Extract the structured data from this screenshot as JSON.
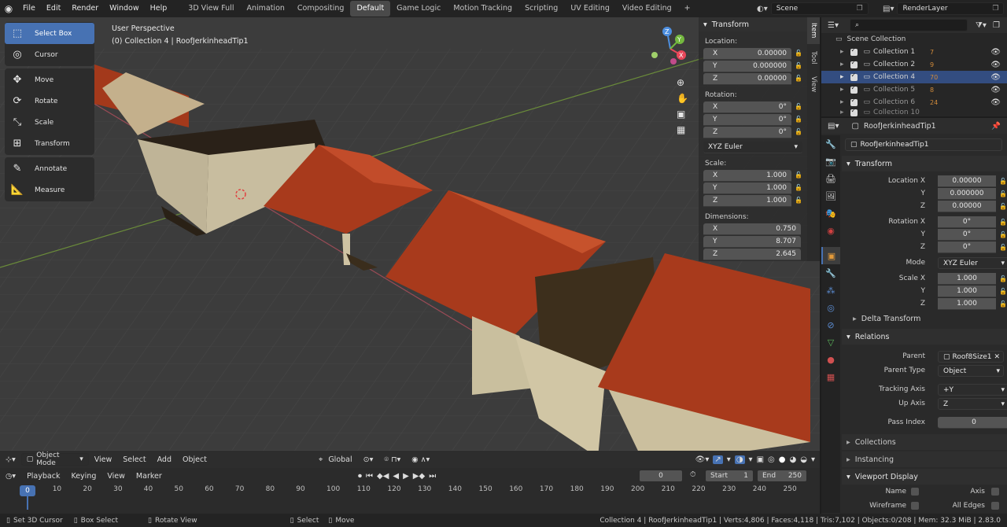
{
  "menus": [
    "File",
    "Edit",
    "Render",
    "Window",
    "Help"
  ],
  "workspaces": [
    {
      "label": "3D View Full",
      "active": false
    },
    {
      "label": "Animation",
      "active": false
    },
    {
      "label": "Compositing",
      "active": false
    },
    {
      "label": "Default",
      "active": true
    },
    {
      "label": "Game Logic",
      "active": false
    },
    {
      "label": "Motion Tracking",
      "active": false
    },
    {
      "label": "Scripting",
      "active": false
    },
    {
      "label": "UV Editing",
      "active": false
    },
    {
      "label": "Video Editing",
      "active": false
    }
  ],
  "scene": "Scene",
  "render_layer": "RenderLayer",
  "viewport": {
    "perspective": "User Perspective",
    "context": "(0) Collection 4 | RoofJerkinheadTip1"
  },
  "tools": [
    {
      "label": "Select Box",
      "icon": "select-box-icon",
      "active": true,
      "group": 1
    },
    {
      "label": "Cursor",
      "icon": "cursor-icon",
      "active": false,
      "group": 1
    },
    {
      "label": "Move",
      "icon": "move-icon",
      "active": false,
      "group": 2
    },
    {
      "label": "Rotate",
      "icon": "rotate-icon",
      "active": false,
      "group": 2
    },
    {
      "label": "Scale",
      "icon": "scale-icon",
      "active": false,
      "group": 2
    },
    {
      "label": "Transform",
      "icon": "transform-icon",
      "active": false,
      "group": 2
    },
    {
      "label": "Annotate",
      "icon": "annotate-icon",
      "active": false,
      "group": 3
    },
    {
      "label": "Measure",
      "icon": "measure-icon",
      "active": false,
      "group": 3
    }
  ],
  "npanel": {
    "title": "Transform",
    "location_label": "Location:",
    "location": [
      {
        "axis": "X",
        "value": "0.00000"
      },
      {
        "axis": "Y",
        "value": "0.000000"
      },
      {
        "axis": "Z",
        "value": "0.00000"
      }
    ],
    "rotation_label": "Rotation:",
    "rotation": [
      {
        "axis": "X",
        "value": "0°"
      },
      {
        "axis": "Y",
        "value": "0°"
      },
      {
        "axis": "Z",
        "value": "0°"
      }
    ],
    "rotation_mode": "XYZ Euler",
    "scale_label": "Scale:",
    "scale": [
      {
        "axis": "X",
        "value": "1.000"
      },
      {
        "axis": "Y",
        "value": "1.000"
      },
      {
        "axis": "Z",
        "value": "1.000"
      }
    ],
    "dimensions_label": "Dimensions:",
    "dimensions": [
      {
        "axis": "X",
        "value": "0.750"
      },
      {
        "axis": "Y",
        "value": "8.707"
      },
      {
        "axis": "Z",
        "value": "2.645"
      }
    ],
    "tabs": [
      "Item",
      "Tool",
      "View"
    ]
  },
  "vp_header": {
    "mode": "Object Mode",
    "menus": [
      "View",
      "Select",
      "Add",
      "Object"
    ],
    "orientation": "Global"
  },
  "timeline": {
    "menus": [
      "Playback",
      "Keying",
      "View",
      "Marker"
    ],
    "current_frame": "0",
    "start_label": "Start",
    "start": "1",
    "end_label": "End",
    "end": "250",
    "ticks": [
      "0",
      "10",
      "20",
      "30",
      "40",
      "50",
      "60",
      "70",
      "80",
      "90",
      "100",
      "110",
      "120",
      "130",
      "140",
      "150",
      "160",
      "170",
      "180",
      "190",
      "200",
      "210",
      "220",
      "230",
      "240",
      "250"
    ],
    "playhead_frame": "0"
  },
  "status": {
    "items": [
      "Set 3D Cursor",
      "Box Select",
      "Rotate View",
      "Select",
      "Move"
    ],
    "info": "Collection 4 | RoofJerkinheadTip1 | Verts:4,806 | Faces:4,118 | Tris:7,102 | Objects:0/208 | Mem: 32.3 MiB | 2.83.0"
  },
  "outliner": {
    "root": "Scene Collection",
    "rows": [
      {
        "label": "Collection 1",
        "badge": "7",
        "selected": false
      },
      {
        "label": "Collection 2",
        "badge": "9",
        "selected": false
      },
      {
        "label": "Collection 4",
        "badge": "70",
        "selected": true
      },
      {
        "label": "Collection 5",
        "badge": "8",
        "selected": false
      },
      {
        "label": "Collection 6",
        "badge": "24",
        "selected": false
      },
      {
        "label": "Collection 10",
        "badge": "",
        "selected": false
      }
    ]
  },
  "properties": {
    "object_name": "RoofJerkinheadTip1",
    "object_field": "RoofJerkinheadTip1",
    "transform_title": "Transform",
    "location_x_label": "Location X",
    "location": [
      "0.00000",
      "0.000000",
      "0.00000"
    ],
    "rotation_x_label": "Rotation X",
    "rotation": [
      "0°",
      "0°",
      "0°"
    ],
    "mode_label": "Mode",
    "mode": "XYZ Euler",
    "scale_x_label": "Scale X",
    "scale": [
      "1.000",
      "1.000",
      "1.000"
    ],
    "y_label": "Y",
    "z_label": "Z",
    "delta_transform": "Delta Transform",
    "relations_title": "Relations",
    "parent_label": "Parent",
    "parent": "Roof8Size1",
    "parent_type_label": "Parent Type",
    "parent_type": "Object",
    "tracking_axis_label": "Tracking Axis",
    "tracking_axis": "+Y",
    "up_axis_label": "Up Axis",
    "up_axis": "Z",
    "pass_index_label": "Pass Index",
    "pass_index": "0",
    "collections": "Collections",
    "instancing": "Instancing",
    "viewport_display": "Viewport Display",
    "name_label": "Name",
    "axis_label": "Axis",
    "wireframe_label": "Wireframe",
    "all_edges_label": "All Edges"
  },
  "colors": {
    "accent": "#4772b3",
    "roof": "#a83a1c",
    "wall": "#c9bd9c",
    "grid": "#444444"
  }
}
